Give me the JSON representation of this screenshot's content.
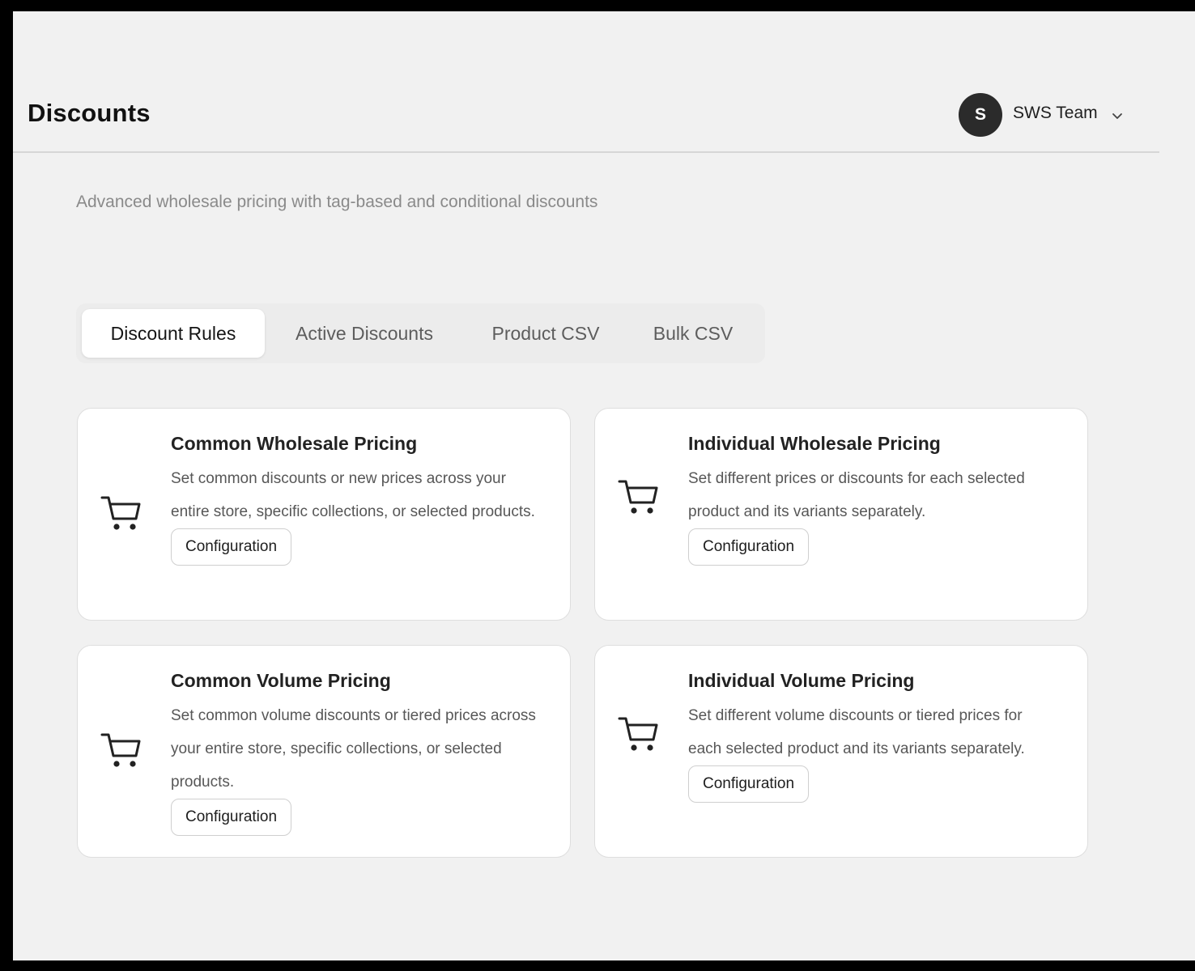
{
  "header": {
    "title": "Discounts",
    "user": {
      "avatar_initial": "S",
      "name": "SWS Team",
      "dropdown_icon": "chevron-down-icon"
    }
  },
  "subtitle": "Advanced wholesale pricing with tag-based and conditional discounts",
  "tabs": [
    {
      "label": "Discount Rules",
      "active": true
    },
    {
      "label": "Active Discounts",
      "active": false
    },
    {
      "label": "Product CSV",
      "active": false
    },
    {
      "label": "Bulk CSV",
      "active": false
    }
  ],
  "cards": [
    {
      "icon": "cart-icon",
      "title": "Common Wholesale Pricing",
      "description": "Set common discounts or new prices across your entire store, specific collections, or selected products.",
      "button_label": "Configuration"
    },
    {
      "icon": "cart-icon",
      "title": "Individual Wholesale Pricing",
      "description": "Set different prices or discounts for each selected product and its variants separately.",
      "button_label": "Configuration"
    },
    {
      "icon": "cart-icon",
      "title": "Common Volume Pricing",
      "description": "Set common volume discounts or tiered prices across your entire store, specific collections, or selected products.",
      "button_label": "Configuration"
    },
    {
      "icon": "cart-icon",
      "title": "Individual Volume Pricing",
      "description": "Set different volume discounts or tiered prices for each selected product and its variants separately.",
      "button_label": "Configuration"
    }
  ],
  "colors": {
    "background": "#f1f1f1",
    "card": "#ffffff",
    "avatar": "#2b2b2b",
    "text_primary": "#111111",
    "text_muted": "#8a8a8a"
  }
}
